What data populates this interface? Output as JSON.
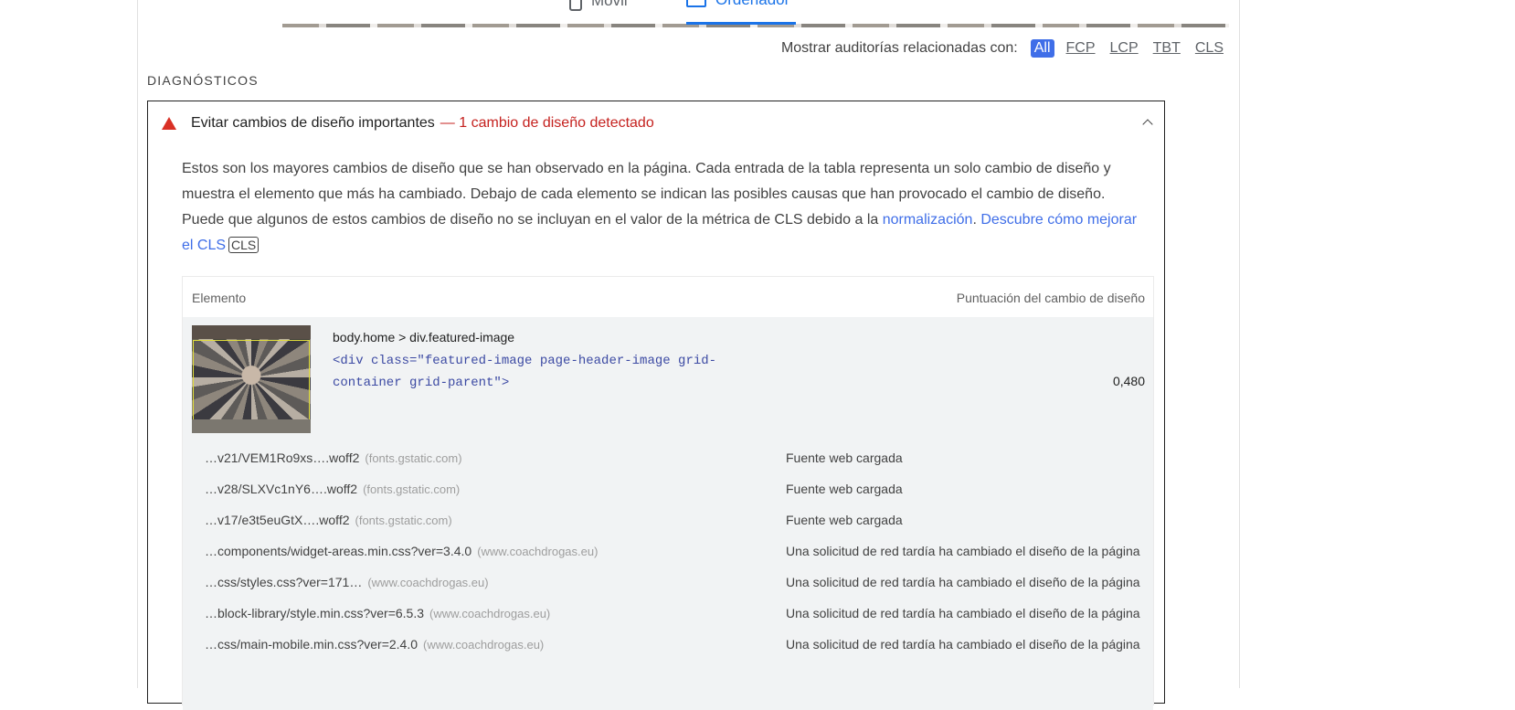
{
  "device_tabs": {
    "mobile": "Móvil",
    "desktop": "Ordenador"
  },
  "filter": {
    "label": "Mostrar auditorías relacionadas con:",
    "options": [
      "All",
      "FCP",
      "LCP",
      "TBT",
      "CLS"
    ],
    "selected": "All"
  },
  "section_title": "DIAGNÓSTICOS",
  "audit": {
    "title": "Evitar cambios de diseño importantes",
    "display_value": "— 1 cambio de diseño detectado",
    "status": "fail",
    "description_text": "Estos son los mayores cambios de diseño que se han observado en la página. Cada entrada de la tabla representa un solo cambio de diseño y muestra el elemento que más ha cambiado. Debajo de cada elemento se indican las posibles causas que han provocado el cambio de diseño. Puede que algunos de estos cambios de diseño no se incluyan en el valor de la métrica de CLS debido a la ",
    "link_normalization": "normalización",
    "link_learn": "Descubre cómo mejorar el CLS",
    "metric_badge": "CLS"
  },
  "table": {
    "col_element": "Elemento",
    "col_score": "Puntuación del cambio de diseño",
    "row": {
      "node_path": "body.home > div.featured-image",
      "snippet": "<div class=\"featured-image page-header-image grid-container grid-parent\">",
      "score": "0,480"
    },
    "subitems": [
      {
        "src": "…v21/VEM1Ro9xs….woff2",
        "host": "(fonts.gstatic.com)",
        "reason": "Fuente web cargada"
      },
      {
        "src": "…v28/SLXVc1nY6….woff2",
        "host": "(fonts.gstatic.com)",
        "reason": "Fuente web cargada"
      },
      {
        "src": "…v17/e3t5euGtX….woff2",
        "host": "(fonts.gstatic.com)",
        "reason": "Fuente web cargada"
      },
      {
        "src": "…components/widget-areas.min.css?ver=3.4.0",
        "host": "(www.coachdrogas.eu)",
        "reason": "Una solicitud de red tardía ha cambiado el diseño de la página"
      },
      {
        "src": "…css/styles.css?ver=171…",
        "host": "(www.coachdrogas.eu)",
        "reason": "Una solicitud de red tardía ha cambiado el diseño de la página"
      },
      {
        "src": "…block-library/style.min.css?ver=6.5.3",
        "host": "(www.coachdrogas.eu)",
        "reason": "Una solicitud de red tardía ha cambiado el diseño de la página"
      },
      {
        "src": "…css/main-mobile.min.css?ver=2.4.0",
        "host": "(www.coachdrogas.eu)",
        "reason": "Una solicitud de red tardía ha cambiado el diseño de la página"
      }
    ]
  }
}
